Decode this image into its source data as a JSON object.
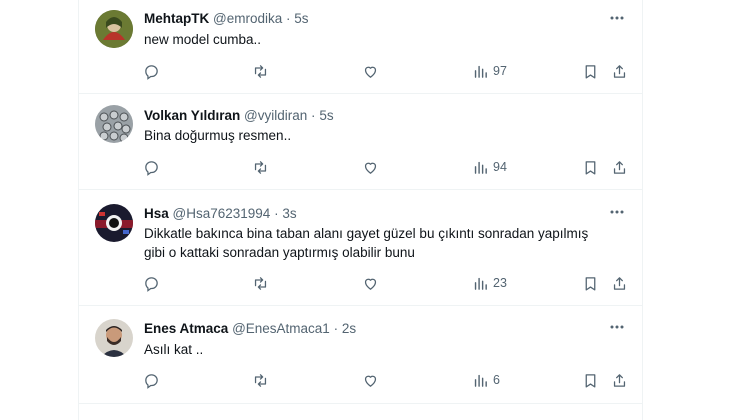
{
  "tweets": [
    {
      "name": "MehtapTK",
      "handle": "@emrodika",
      "dot": "·",
      "time": "5s",
      "lines": [
        "new model cumba.."
      ],
      "views": "97",
      "avatar": "avatar-mehtap"
    },
    {
      "name": "Volkan Yıldıran",
      "handle": "@vyildiran",
      "dot": "·",
      "time": "5s",
      "lines": [
        "Bina doğurmuş resmen.."
      ],
      "views": "94",
      "avatar": "avatar-volkan"
    },
    {
      "name": "Hsa",
      "handle": "@Hsa76231994",
      "dot": "·",
      "time": "3s",
      "lines": [
        "Dikkatle bakınca bina taban alanı gayet güzel bu çıkıntı sonradan yapılmış",
        "gibi o kattaki sonradan yaptırmış olabilir bunu"
      ],
      "views": "23",
      "avatar": "avatar-hsa"
    },
    {
      "name": "Enes Atmaca",
      "handle": "@EnesAtmaca1",
      "dot": "·",
      "time": "2s",
      "lines": [
        "Asılı kat .."
      ],
      "views": "6",
      "avatar": "avatar-enes"
    }
  ],
  "icons": {
    "reply": "reply-icon",
    "retweet": "retweet-icon",
    "like": "heart-icon",
    "views": "analytics-icon",
    "bookmark": "bookmark-icon",
    "share": "share-icon",
    "more": "more-icon"
  },
  "colors": {
    "text": "#0f1419",
    "secondary": "#536471",
    "divider": "#eff3f4"
  }
}
